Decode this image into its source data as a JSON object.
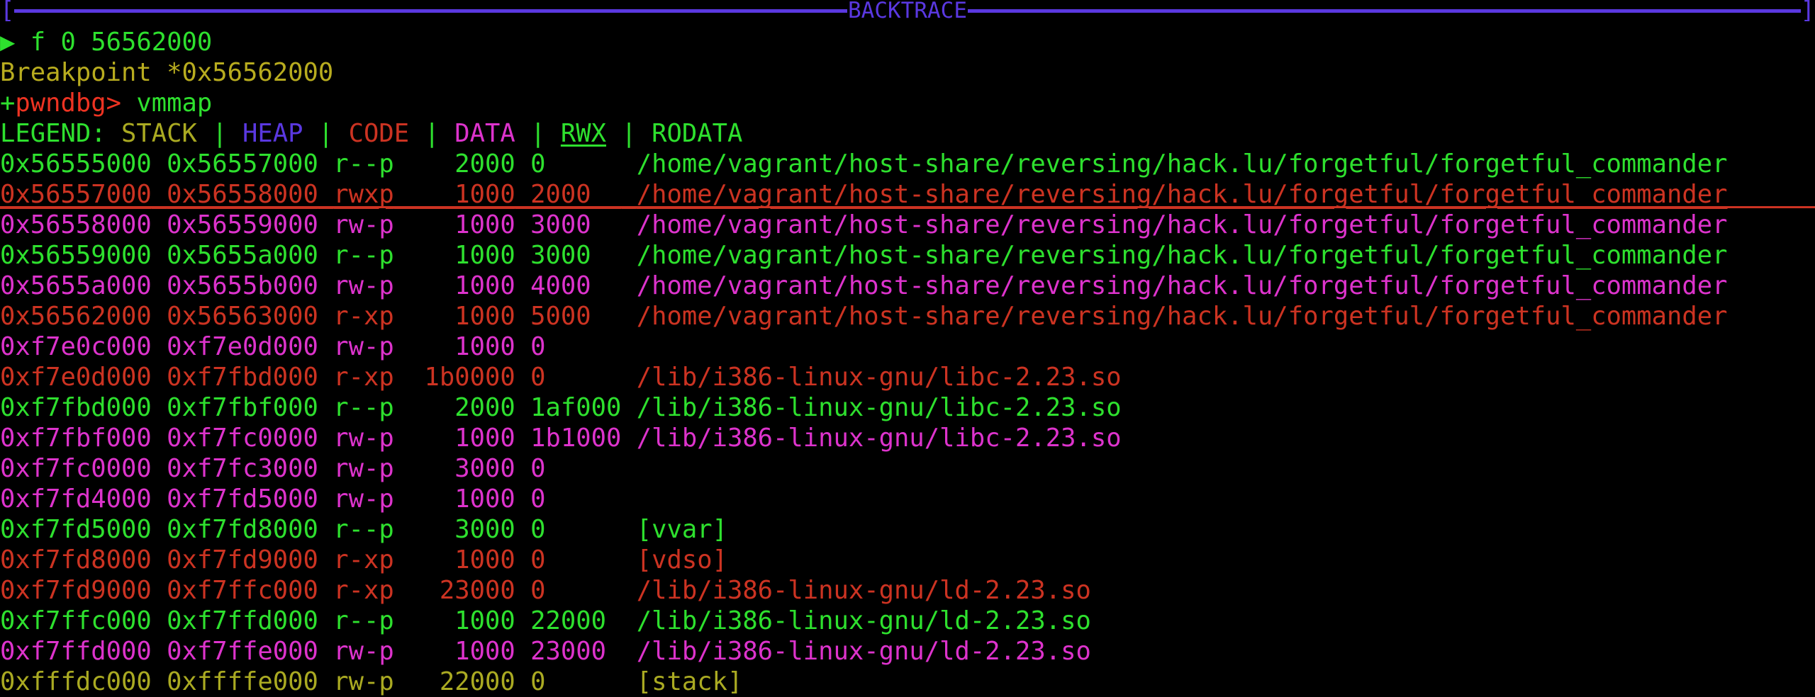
{
  "window": {
    "panel_title": "BACKTRACE",
    "bracket_open": "[",
    "bracket_close": "]"
  },
  "colors": {
    "border": "#5a38e0",
    "stack": "#aaaa22",
    "heap": "#5a38e0",
    "code": "#cc3322",
    "data": "#dd33cc",
    "rwx": "#2ee02e",
    "rodata": "#2ee02e",
    "prompt_red": "#ee3322",
    "prompt_green": "#2ee02e",
    "breakpoint_yellow": "#b8ac1f",
    "background": "#000000"
  },
  "backtrace": {
    "marker": "▶",
    "frame": "f 0 56562000"
  },
  "breakpoint": {
    "text": "Breakpoint *0x56562000"
  },
  "prompt": {
    "plus": "+",
    "name": "pwndbg>",
    "command": "vmmap"
  },
  "legend": {
    "label": "LEGEND:",
    "sep": "|",
    "items": [
      {
        "label": "STACK",
        "color_key": "stack",
        "underline": false
      },
      {
        "label": "HEAP",
        "color_key": "heap",
        "underline": false
      },
      {
        "label": "CODE",
        "color_key": "code",
        "underline": false
      },
      {
        "label": "DATA",
        "color_key": "data",
        "underline": false
      },
      {
        "label": "RWX",
        "color_key": "rwx",
        "underline": true
      },
      {
        "label": "RODATA",
        "color_key": "rodata",
        "underline": false
      }
    ]
  },
  "vmmap": {
    "columns": [
      "start",
      "end",
      "perm",
      "size",
      "offset",
      "objfile"
    ],
    "rows": [
      {
        "start": "0x56555000",
        "end": "0x56557000",
        "perm": "r--p",
        "size": "2000",
        "offset": "0",
        "objfile": "/home/vagrant/host-share/reversing/hack.lu/forgetful/forgetful_commander",
        "color_key": "rodata",
        "highlight": false
      },
      {
        "start": "0x56557000",
        "end": "0x56558000",
        "perm": "rwxp",
        "size": "1000",
        "offset": "2000",
        "objfile": "/home/vagrant/host-share/reversing/hack.lu/forgetful/forgetful_commander",
        "color_key": "code",
        "highlight": true
      },
      {
        "start": "0x56558000",
        "end": "0x56559000",
        "perm": "rw-p",
        "size": "1000",
        "offset": "3000",
        "objfile": "/home/vagrant/host-share/reversing/hack.lu/forgetful/forgetful_commander",
        "color_key": "data",
        "highlight": false
      },
      {
        "start": "0x56559000",
        "end": "0x5655a000",
        "perm": "r--p",
        "size": "1000",
        "offset": "3000",
        "objfile": "/home/vagrant/host-share/reversing/hack.lu/forgetful/forgetful_commander",
        "color_key": "rodata",
        "highlight": false
      },
      {
        "start": "0x5655a000",
        "end": "0x5655b000",
        "perm": "rw-p",
        "size": "1000",
        "offset": "4000",
        "objfile": "/home/vagrant/host-share/reversing/hack.lu/forgetful/forgetful_commander",
        "color_key": "data",
        "highlight": false
      },
      {
        "start": "0x56562000",
        "end": "0x56563000",
        "perm": "r-xp",
        "size": "1000",
        "offset": "5000",
        "objfile": "/home/vagrant/host-share/reversing/hack.lu/forgetful/forgetful_commander",
        "color_key": "code",
        "highlight": false
      },
      {
        "start": "0xf7e0c000",
        "end": "0xf7e0d000",
        "perm": "rw-p",
        "size": "1000",
        "offset": "0",
        "objfile": "",
        "color_key": "data",
        "highlight": false
      },
      {
        "start": "0xf7e0d000",
        "end": "0xf7fbd000",
        "perm": "r-xp",
        "size": "1b0000",
        "offset": "0",
        "objfile": "/lib/i386-linux-gnu/libc-2.23.so",
        "color_key": "code",
        "highlight": false
      },
      {
        "start": "0xf7fbd000",
        "end": "0xf7fbf000",
        "perm": "r--p",
        "size": "2000",
        "offset": "1af000",
        "objfile": "/lib/i386-linux-gnu/libc-2.23.so",
        "color_key": "rodata",
        "highlight": false
      },
      {
        "start": "0xf7fbf000",
        "end": "0xf7fc0000",
        "perm": "rw-p",
        "size": "1000",
        "offset": "1b1000",
        "objfile": "/lib/i386-linux-gnu/libc-2.23.so",
        "color_key": "data",
        "highlight": false
      },
      {
        "start": "0xf7fc0000",
        "end": "0xf7fc3000",
        "perm": "rw-p",
        "size": "3000",
        "offset": "0",
        "objfile": "",
        "color_key": "data",
        "highlight": false
      },
      {
        "start": "0xf7fd4000",
        "end": "0xf7fd5000",
        "perm": "rw-p",
        "size": "1000",
        "offset": "0",
        "objfile": "",
        "color_key": "data",
        "highlight": false
      },
      {
        "start": "0xf7fd5000",
        "end": "0xf7fd8000",
        "perm": "r--p",
        "size": "3000",
        "offset": "0",
        "objfile": "[vvar]",
        "color_key": "rodata",
        "highlight": false
      },
      {
        "start": "0xf7fd8000",
        "end": "0xf7fd9000",
        "perm": "r-xp",
        "size": "1000",
        "offset": "0",
        "objfile": "[vdso]",
        "color_key": "code",
        "highlight": false
      },
      {
        "start": "0xf7fd9000",
        "end": "0xf7ffc000",
        "perm": "r-xp",
        "size": "23000",
        "offset": "0",
        "objfile": "/lib/i386-linux-gnu/ld-2.23.so",
        "color_key": "code",
        "highlight": false
      },
      {
        "start": "0xf7ffc000",
        "end": "0xf7ffd000",
        "perm": "r--p",
        "size": "1000",
        "offset": "22000",
        "objfile": "/lib/i386-linux-gnu/ld-2.23.so",
        "color_key": "rodata",
        "highlight": false
      },
      {
        "start": "0xf7ffd000",
        "end": "0xf7ffe000",
        "perm": "rw-p",
        "size": "1000",
        "offset": "23000",
        "objfile": "/lib/i386-linux-gnu/ld-2.23.so",
        "color_key": "data",
        "highlight": false
      },
      {
        "start": "0xfffdc000",
        "end": "0xffffe000",
        "perm": "rw-p",
        "size": "22000",
        "offset": "0",
        "objfile": "[stack]",
        "color_key": "stack",
        "highlight": false
      }
    ]
  }
}
